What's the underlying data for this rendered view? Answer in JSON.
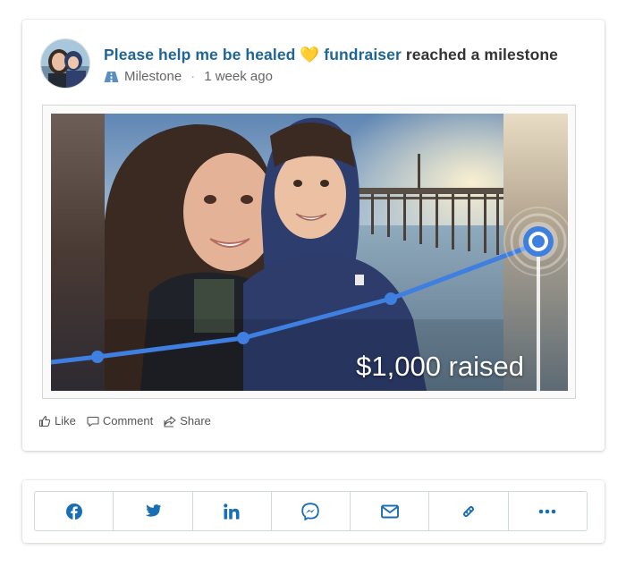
{
  "post": {
    "headline_link": "Please help me be healed",
    "heart": "💛",
    "fundraiser_word": "fundraiser",
    "headline_suffix": "reached a milestone",
    "meta_label": "Milestone",
    "meta_sep": "·",
    "meta_time": "1 week ago",
    "media_caption": "$1,000 raised",
    "progress_fraction": 1.0
  },
  "actions": [
    {
      "label": "Like",
      "icon": "thumbs-up-icon"
    },
    {
      "label": "Comment",
      "icon": "comment-icon"
    },
    {
      "label": "Share",
      "icon": "share-icon"
    }
  ],
  "share_buttons": [
    {
      "icon": "facebook-icon"
    },
    {
      "icon": "twitter-icon"
    },
    {
      "icon": "linkedin-icon"
    },
    {
      "icon": "messenger-icon"
    },
    {
      "icon": "email-icon"
    },
    {
      "icon": "link-icon"
    },
    {
      "icon": "more-icon"
    }
  ],
  "colors": {
    "link": "#1f6696",
    "share_icon": "#1a6fb3",
    "chart_line": "#3f7fe0",
    "heart": "#f5b400"
  }
}
